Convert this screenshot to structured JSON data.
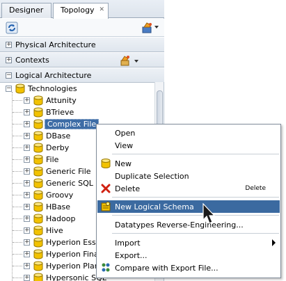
{
  "tabs": [
    {
      "label": "Designer"
    },
    {
      "label": "Topology",
      "close": "✕"
    }
  ],
  "sections": [
    {
      "label": "Physical Architecture",
      "expander": "+"
    },
    {
      "label": "Contexts",
      "expander": "+"
    },
    {
      "label": "Logical Architecture",
      "expander": "−"
    }
  ],
  "tree": {
    "root": {
      "label": "Technologies",
      "expander": "−"
    },
    "items": [
      {
        "label": "Attunity"
      },
      {
        "label": "BTrieve"
      },
      {
        "label": "Complex File",
        "selected": true
      },
      {
        "label": "DBase"
      },
      {
        "label": "Derby"
      },
      {
        "label": "File"
      },
      {
        "label": "Generic File"
      },
      {
        "label": "Generic SQL"
      },
      {
        "label": "Groovy"
      },
      {
        "label": "HBase"
      },
      {
        "label": "Hadoop"
      },
      {
        "label": "Hive"
      },
      {
        "label": "Hyperion Ess"
      },
      {
        "label": "Hyperion Fina"
      },
      {
        "label": "Hyperion Plar"
      },
      {
        "label": "Hypersonic SQL"
      }
    ],
    "item_expander": "+"
  },
  "context_menu": {
    "items": [
      {
        "label": "Open"
      },
      {
        "label": "View"
      },
      {
        "label": "New",
        "icon": "new-db-icon"
      },
      {
        "label": "Duplicate Selection"
      },
      {
        "label": "Delete",
        "icon": "red-x-icon",
        "accelerator": "Delete"
      },
      {
        "label": "New Logical Schema",
        "icon": "logical-schema-icon",
        "highlighted": true
      },
      {
        "label": "Datatypes Reverse-Engineering..."
      },
      {
        "label": "Import",
        "submenu": true
      },
      {
        "label": "Export..."
      },
      {
        "label": "Compare with Export File...",
        "icon": "compare-icon"
      }
    ]
  },
  "colors": {
    "selection": "#3d6ca6",
    "menu_highlight": "#3b6aa0",
    "db_icon": "#f2c200"
  }
}
